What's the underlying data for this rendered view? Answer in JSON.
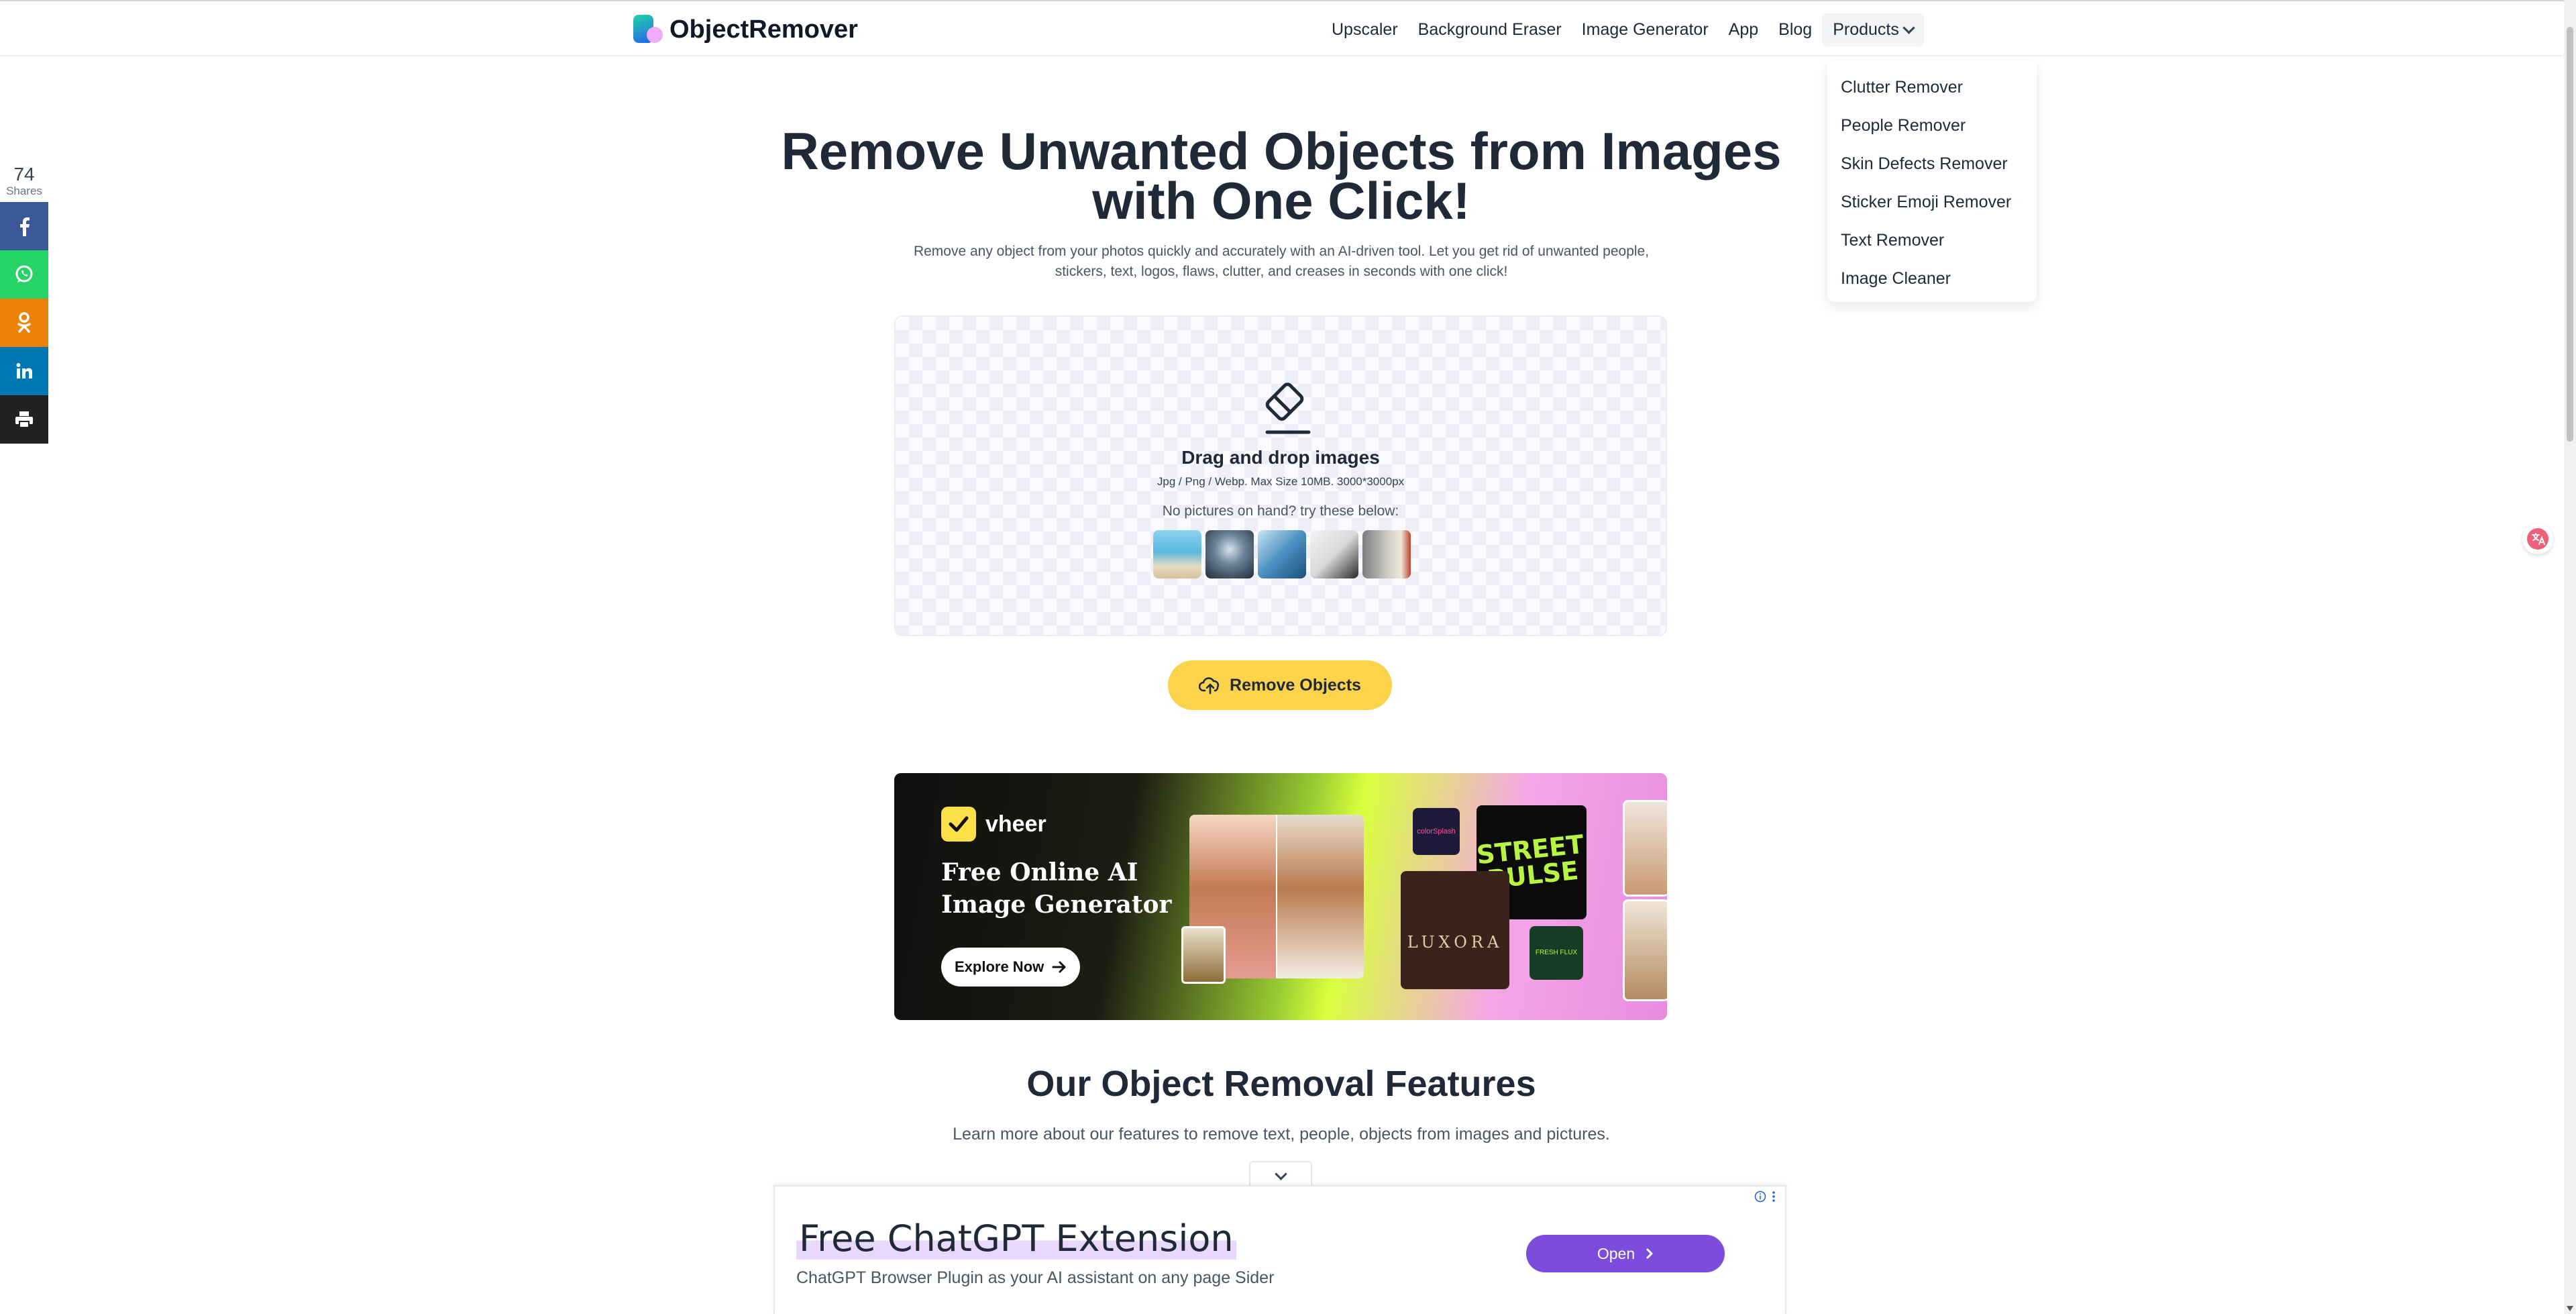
{
  "header": {
    "logo_text": "ObjectRemover",
    "nav": [
      "Upscaler",
      "Background Eraser",
      "Image Generator",
      "App",
      "Blog"
    ],
    "products_label": "Products"
  },
  "products_menu": [
    "Clutter Remover",
    "People Remover",
    "Skin Defects Remover",
    "Sticker Emoji Remover",
    "Text Remover",
    "Image Cleaner"
  ],
  "share": {
    "count": "74",
    "label": "Shares",
    "buttons": [
      "facebook-icon",
      "whatsapp-icon",
      "odnoklassniki-icon",
      "linkedin-icon",
      "print-icon"
    ]
  },
  "hero": {
    "title": "Remove Unwanted Objects from Images with One Click!",
    "subtitle": "Remove any object from your photos quickly and accurately with an AI-driven tool. Let you get rid of unwanted people, stickers, text, logos, flaws, clutter, and creases in seconds with one click!"
  },
  "upload": {
    "title": "Drag and drop images",
    "formats": "Jpg / Png / Webp. Max Size 10MB. 3000*3000px",
    "try_text": "No pictures on hand? try these below:",
    "button_label": "Remove Objects"
  },
  "banner": {
    "brand": "vheer",
    "title": "Free Online AI Image Generator",
    "cta": "Explore Now",
    "tile_texts": [
      "colorSplash",
      "STREET PULSE",
      "LUXORA",
      "FRESH FLUX"
    ]
  },
  "features": {
    "title": "Our Object Removal Features",
    "subtitle": "Learn more about our features to remove text, people, objects from images and pictures."
  },
  "bottom_ad": {
    "title": "Free ChatGPT Extension",
    "subtitle": "ChatGPT Browser Plugin as your AI assistant on any page Sider",
    "button": "Open"
  },
  "colors": {
    "accent_button": "#fbd44c",
    "ad_button": "#7c4ddc",
    "text_dark": "#1f2937"
  }
}
